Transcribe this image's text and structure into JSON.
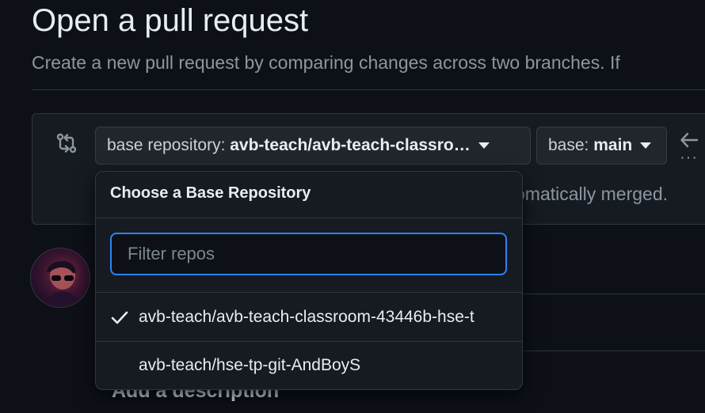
{
  "page": {
    "title": "Open a pull request",
    "subtitle": "Create a new pull request by comparing changes across two branches. If"
  },
  "compare": {
    "base_repo_prefix": "base repository: ",
    "base_repo_value": "avb-teach/avb-teach-classro…",
    "base_branch_prefix": "base: ",
    "base_branch_value": "main",
    "merge_status_fragment": "omatically merged.",
    "ellipsis": "···"
  },
  "dropdown": {
    "header": "Choose a Base Repository",
    "filter_placeholder": "Filter repos",
    "filter_value": "",
    "items": [
      {
        "label": "avb-teach/avb-teach-classroom-43446b-hse-t",
        "selected": true
      },
      {
        "label": "avb-teach/hse-tp-git-AndBoyS",
        "selected": false
      }
    ]
  },
  "description": {
    "heading": "Add a description"
  },
  "icons": {
    "compare": "git-compare-icon",
    "caret": "triangle-down-icon",
    "arrow": "arrow-left-icon",
    "check": "check-icon"
  },
  "colors": {
    "background": "#0d1117",
    "panel": "#161b22",
    "border": "#30363d",
    "focus": "#2f81f7",
    "muted_text": "#8d96a0"
  }
}
